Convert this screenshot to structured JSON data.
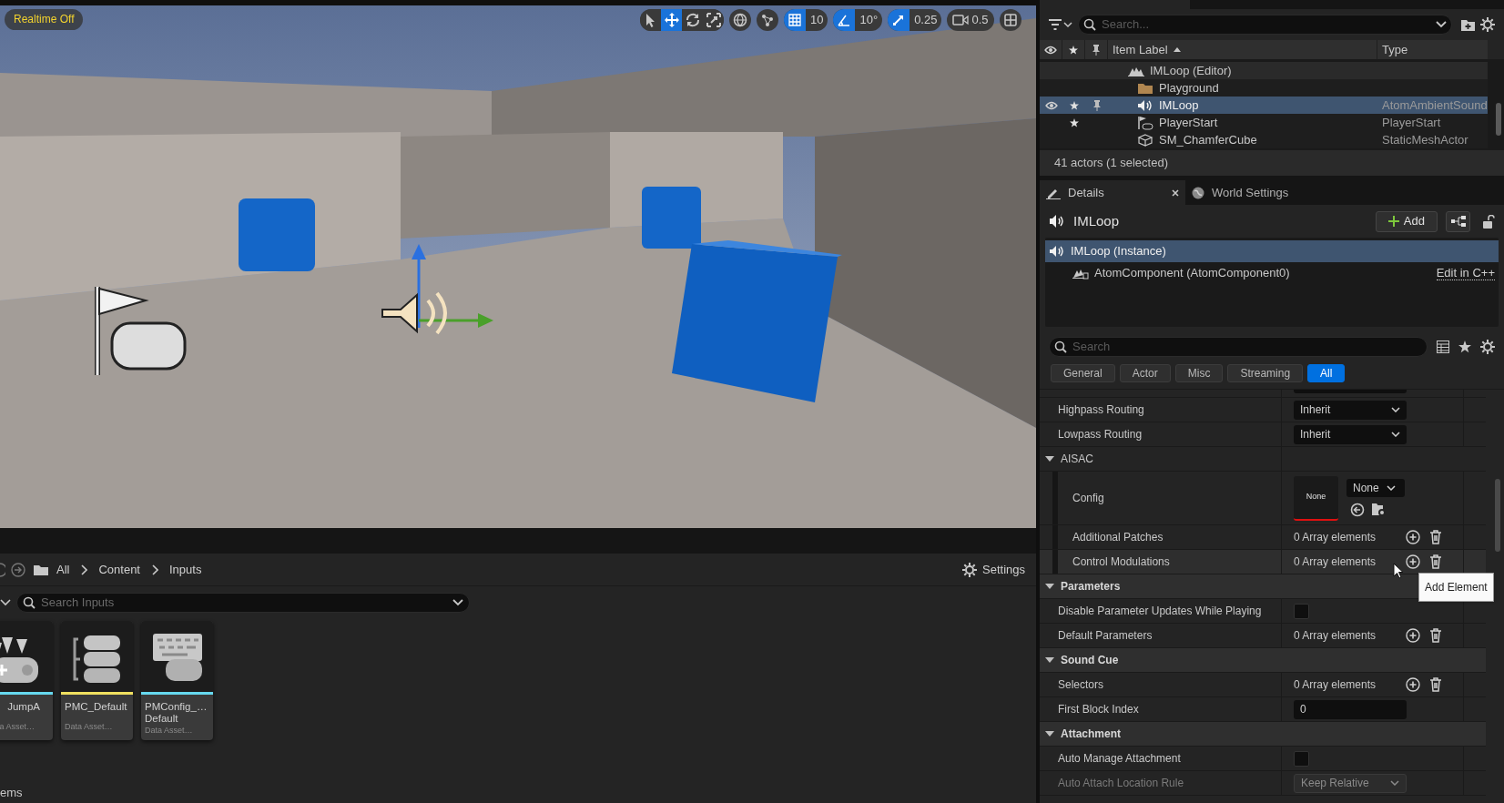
{
  "viewport": {
    "realtime_badge": "Realtime Off",
    "tools": [
      {
        "kind": "select",
        "selected": false
      },
      {
        "kind": "translate",
        "selected": true
      },
      {
        "kind": "rotate",
        "selected": false
      },
      {
        "kind": "scale",
        "selected": false
      }
    ],
    "grid_snap": {
      "on": true,
      "value": "10"
    },
    "rotation_snap": {
      "on": true,
      "value": "10°"
    },
    "scale_snap": {
      "on": true,
      "value": "0.25"
    },
    "camera_speed": "0.5"
  },
  "content_browser": {
    "breadcrumb": [
      "All",
      "Content",
      "Inputs"
    ],
    "settings_label": "Settings",
    "search": {
      "placeholder": "Search Inputs"
    },
    "assets": [
      {
        "kind": "action",
        "name_lines": [
          "JumpA"
        ],
        "type": "a Asset…",
        "color": "#66d9ef"
      },
      {
        "kind": "context",
        "name_lines": [
          "PMC_Default"
        ],
        "type": "Data Asset…",
        "color": "#f0e060"
      },
      {
        "kind": "config",
        "name_lines": [
          "PMConfig_…",
          "Default"
        ],
        "type": "Data Asset…",
        "color": "#66d9ef"
      }
    ],
    "item_count": "ems"
  },
  "outliner": {
    "search": {
      "placeholder": "Search..."
    },
    "columns": [
      "Item Label",
      "Type"
    ],
    "rows": [
      {
        "kind": "world",
        "label": "IMLoop (Editor)",
        "selected": false,
        "eye": false,
        "star": false,
        "pin": false,
        "children": [
          {
            "kind": "folder",
            "label": "Playground",
            "selected": false,
            "eye": false,
            "star": false,
            "pin": false
          },
          {
            "kind": "sound",
            "label": "IMLoop",
            "type": "AtomAmbientSound",
            "selected": true,
            "eye": true,
            "star": true,
            "pin": true
          },
          {
            "kind": "playerstart",
            "label": "PlayerStart",
            "type": "PlayerStart",
            "selected": false,
            "eye": false,
            "star": true,
            "pin": false
          },
          {
            "kind": "mesh",
            "label": "SM_ChamferCube",
            "type": "StaticMeshActor",
            "selected": false,
            "eye": false,
            "star": false,
            "pin": false
          }
        ]
      }
    ],
    "status": "41 actors (1 selected)"
  },
  "details": {
    "tabs": [
      {
        "label": "Details",
        "selected": true,
        "closable": true
      },
      {
        "label": "World Settings",
        "selected": false,
        "closable": false
      }
    ],
    "actor_name": "IMLoop",
    "add_button": "Add",
    "components": [
      {
        "kind": "sound",
        "label": "IMLoop (Instance)",
        "selected": true,
        "children": [
          {
            "kind": "component",
            "label": "AtomComponent (AtomComponent0)",
            "link": "Edit in C++",
            "selected": false
          }
        ]
      }
    ],
    "search": {
      "placeholder": "Search"
    },
    "filters": [
      {
        "label": "General",
        "selected": false
      },
      {
        "label": "Actor",
        "selected": false
      },
      {
        "label": "Misc",
        "selected": false
      },
      {
        "label": "Streaming",
        "selected": false
      },
      {
        "label": "All",
        "selected": true
      }
    ],
    "properties": [
      {
        "kind": "dropdown",
        "label": "Highpass Routing",
        "value": "Inherit",
        "disabled": false
      },
      {
        "kind": "dropdown",
        "label": "Lowpass Routing",
        "value": "Inherit",
        "disabled": false
      },
      {
        "kind": "subcategory",
        "label": "AISAC",
        "expanded": true,
        "children": [
          {
            "kind": "asset",
            "label": "Config",
            "thumbnail": "None",
            "value": "None"
          },
          {
            "kind": "array",
            "label": "Additional Patches",
            "value": "0 Array elements",
            "hovered": false
          },
          {
            "kind": "array",
            "label": "Control Modulations",
            "value": "0 Array elements",
            "hovered": true,
            "tooltip": "Add Element"
          }
        ]
      },
      {
        "kind": "category",
        "label": "Parameters",
        "expanded": true,
        "children": [
          {
            "kind": "checkbox",
            "label": "Disable Parameter Updates While Playing",
            "checked": false
          },
          {
            "kind": "array",
            "label": "Default Parameters",
            "value": "0 Array elements",
            "hovered": false
          }
        ]
      },
      {
        "kind": "category",
        "label": "Sound Cue",
        "expanded": true,
        "children": [
          {
            "kind": "array",
            "label": "Selectors",
            "value": "0 Array elements",
            "hovered": false
          },
          {
            "kind": "number",
            "label": "First Block Index",
            "value": "0"
          }
        ]
      },
      {
        "kind": "category",
        "label": "Attachment",
        "expanded": true,
        "children": [
          {
            "kind": "checkbox",
            "label": "Auto Manage Attachment",
            "checked": false
          },
          {
            "kind": "dropdown",
            "label": "Auto Attach Location Rule",
            "value": "Keep Relative",
            "disabled": true
          }
        ]
      }
    ]
  }
}
